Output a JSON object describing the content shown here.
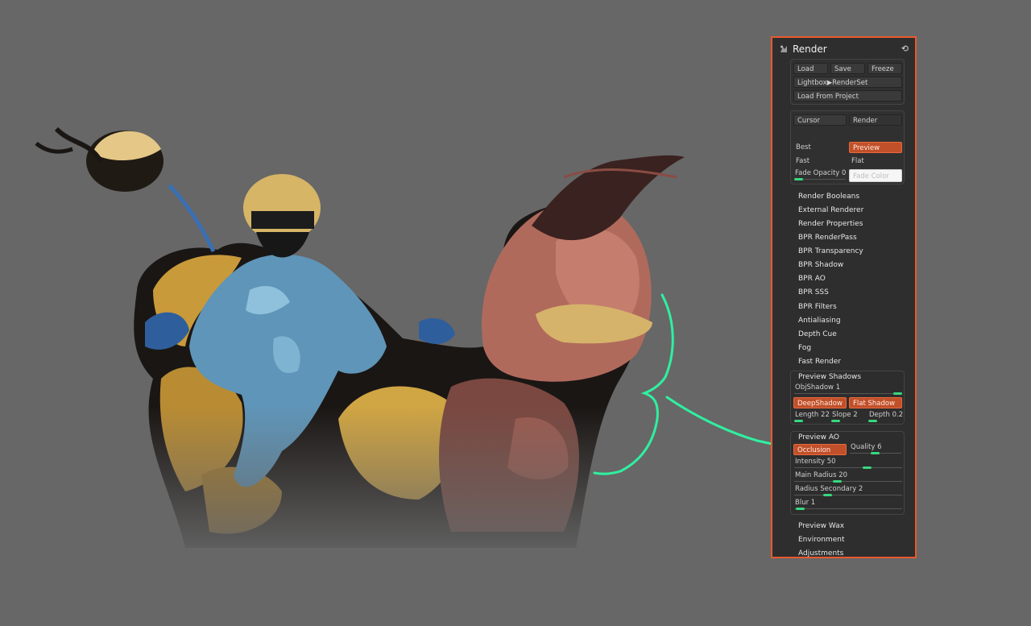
{
  "panel": {
    "title": "Render",
    "icons": {
      "logo": "render-palette-icon",
      "reset": "reset-icon"
    },
    "file_buttons": {
      "load": "Load",
      "save": "Save",
      "freeze": "Freeze"
    },
    "lightbox_renderset": "Lightbox▶RenderSet",
    "load_from_project": "Load From Project",
    "mode_buttons": {
      "cursor": "Cursor",
      "render": "Render"
    },
    "quality": {
      "best": "Best",
      "preview": "Preview",
      "fast": "Fast",
      "flat": "Flat"
    },
    "fade_opacity": {
      "label": "Fade Opacity",
      "value": "0",
      "level": 0.0
    },
    "fade_color": "Fade Color",
    "items": [
      "Render Booleans",
      "External Renderer",
      "Render Properties",
      "BPR RenderPass",
      "BPR Transparency",
      "BPR Shadow",
      "BPR AO",
      "BPR SSS",
      "BPR Filters",
      "Antialiasing",
      "Depth Cue",
      "Fog",
      "Fast Render"
    ],
    "preview_shadows": {
      "title": "Preview Shadows",
      "obj_shadow": {
        "label": "ObjShadow",
        "value": "1"
      },
      "deep_shadow": "DeepShadow",
      "flat_shadow": "Flat Shadow",
      "length": {
        "label": "Length",
        "value": "22"
      },
      "slope": {
        "label": "Slope",
        "value": "2"
      },
      "depth": {
        "label": "Depth",
        "value": "0.2"
      }
    },
    "preview_ao": {
      "title": "Preview AO",
      "occlusion": "Occlusion",
      "quality": {
        "label": "Quality",
        "value": "6"
      },
      "intensity": {
        "label": "Intensity",
        "value": "50"
      },
      "main_radius": {
        "label": "Main Radius",
        "value": "20"
      },
      "radius_secondary": {
        "label": "Radius Secondary",
        "value": "2"
      },
      "blur": {
        "label": "Blur",
        "value": "1"
      }
    },
    "footer_items": [
      "Preview Wax",
      "Environment",
      "Adjustments"
    ]
  },
  "colors": {
    "accent_border": "#e9592d",
    "active_button": "#c0502a",
    "slider_thumb": "#37d87e",
    "annotation": "#2ff0a0"
  }
}
